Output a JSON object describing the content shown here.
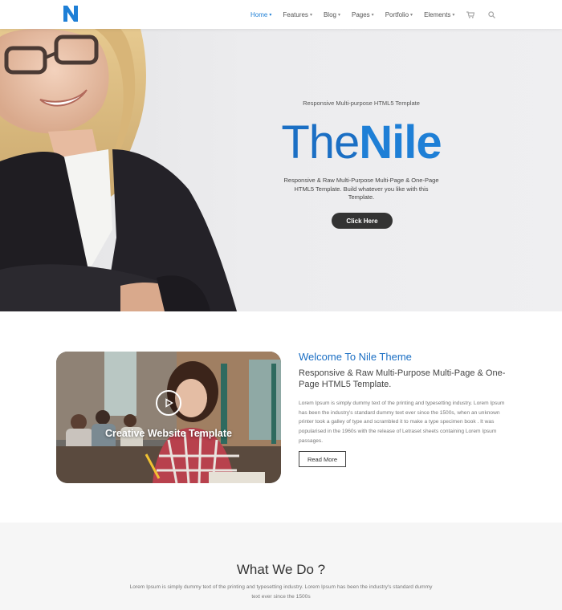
{
  "header": {
    "logo_letter": "N",
    "nav": [
      {
        "label": "Home",
        "active": true
      },
      {
        "label": "Features",
        "active": false
      },
      {
        "label": "Blog",
        "active": false
      },
      {
        "label": "Pages",
        "active": false
      },
      {
        "label": "Portfolio",
        "active": false
      },
      {
        "label": "Elements",
        "active": false
      }
    ],
    "icons": [
      "cart-icon",
      "search-icon"
    ]
  },
  "hero": {
    "kicker": "Responsive Multi-purpose HTML5 Template",
    "title_thin": "The",
    "title_bold": "Nile",
    "description": "Responsive & Raw Multi-Purpose Multi-Page & One-Page HTML5 Template. Build whatever you like with this Template.",
    "button_label": "Click Here"
  },
  "about": {
    "video_caption": "Creative Website Template",
    "title": "Welcome To Nile Theme",
    "subtitle": "Responsive & Raw Multi-Purpose Multi-Page & One-Page HTML5 Template.",
    "text": "Lorem Ipsum is simply dummy text of the printing and typesetting industry. Lorem Ipsum has been the industry's standard dummy text ever since the 1500s, when an unknown printer took a galley of type and scrambled it to make a type specimen book . It was popularised in the 1960s with the release of Letraset sheets containing Lorem Ipsum passages.",
    "button_label": "Read More"
  },
  "what_we_do": {
    "title": "What We Do ?",
    "text": "Lorem Ipsum is simply dummy text of the printing and typesetting industry. Lorem Ipsum has been the industry's standard dummy text ever since the 1500s"
  },
  "colors": {
    "accent": "#1e7fd6",
    "accent_dark": "#1b6fc4",
    "button_dark": "#333333",
    "section_bg": "#f6f6f6"
  }
}
